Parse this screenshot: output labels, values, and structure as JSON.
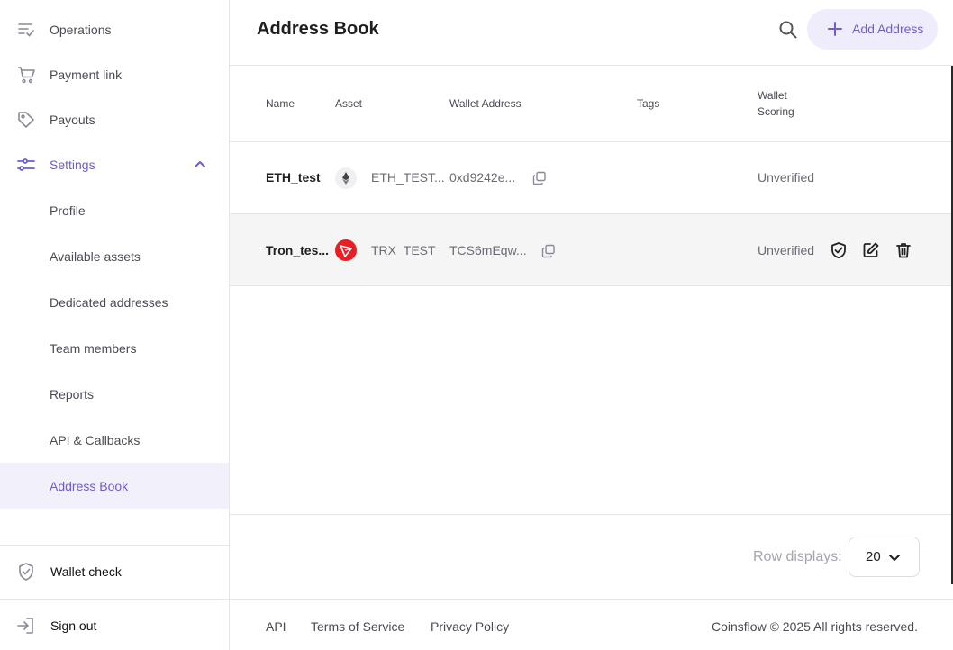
{
  "sidebar": {
    "items": [
      {
        "label": "Operations",
        "icon": "operations-list-icon"
      },
      {
        "label": "Payment link",
        "icon": "cart-icon"
      },
      {
        "label": "Payouts",
        "icon": "tag-icon"
      },
      {
        "label": "Settings",
        "icon": "settings-sliders-icon"
      }
    ],
    "settings_subitems": [
      {
        "label": "Profile"
      },
      {
        "label": "Available assets"
      },
      {
        "label": "Dedicated addresses"
      },
      {
        "label": "Team members"
      },
      {
        "label": "Reports"
      },
      {
        "label": "API & Callbacks"
      },
      {
        "label": "Address Book"
      }
    ],
    "wallet_check": "Wallet check",
    "sign_out": "Sign out"
  },
  "header": {
    "title": "Address Book",
    "add_button": "Add Address"
  },
  "table": {
    "columns": {
      "name": "Name",
      "asset": "Asset",
      "wallet_address": "Wallet Address",
      "tags": "Tags",
      "wallet_scoring_line1": "Wallet",
      "wallet_scoring_line2": "Scoring"
    },
    "rows": [
      {
        "name": "ETH_test",
        "asset": "ETH_TEST...",
        "asset_icon": "ethereum-icon",
        "address": "0xd9242e...",
        "tags": "",
        "scoring": "Unverified"
      },
      {
        "name": "Tron_tes...",
        "asset": "TRX_TEST",
        "asset_icon": "tron-icon",
        "address": "TCS6mEqw...",
        "tags": "",
        "scoring": "Unverified"
      }
    ]
  },
  "pagination": {
    "rows_label": "Row displays:",
    "rows_value": "20"
  },
  "footer": {
    "api": "API",
    "terms": "Terms of Service",
    "privacy": "Privacy Policy",
    "copyright": "Coinsflow © 2025 All rights reserved."
  },
  "colors": {
    "accent": "#6c5dd3",
    "accent_bg": "#efedfb",
    "tron_red": "#ec1c24"
  }
}
